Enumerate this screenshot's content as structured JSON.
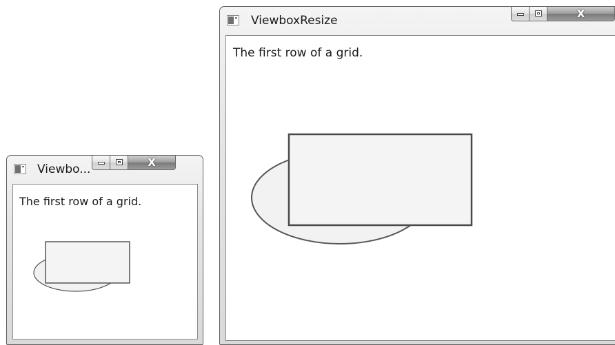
{
  "small_window": {
    "title": "Viewbo...",
    "content_text": "The first row of a grid."
  },
  "large_window": {
    "title": "ViewboxResize",
    "content_text": "The first row of a grid."
  },
  "caption_buttons": {
    "close_label": "X"
  },
  "colors": {
    "shape_fill": "#f2f2f2",
    "shape_stroke": "#4a4a4a",
    "frame": "#e0e0e0"
  },
  "icons": [
    "app-window-icon",
    "minimize-icon",
    "maximize-icon",
    "close-icon"
  ]
}
